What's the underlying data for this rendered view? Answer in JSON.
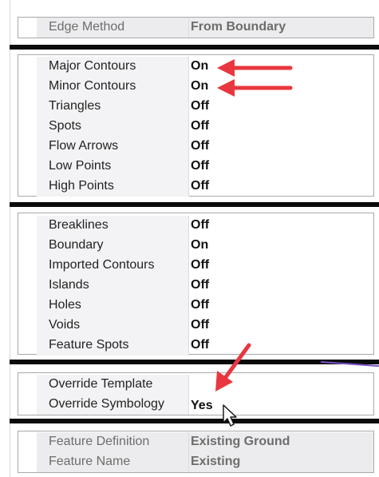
{
  "top_panel": {
    "rows": [
      {
        "label": "Edge Method",
        "value": "From Boundary"
      }
    ]
  },
  "display_panel": {
    "rows": [
      {
        "label": "Major Contours",
        "value": "On"
      },
      {
        "label": "Minor Contours",
        "value": "On"
      },
      {
        "label": "Triangles",
        "value": "Off"
      },
      {
        "label": "Spots",
        "value": "Off"
      },
      {
        "label": "Flow Arrows",
        "value": "Off"
      },
      {
        "label": "Low Points",
        "value": "Off"
      },
      {
        "label": "High Points",
        "value": "Off"
      }
    ]
  },
  "features_panel": {
    "rows": [
      {
        "label": "Breaklines",
        "value": "Off"
      },
      {
        "label": "Boundary",
        "value": "On"
      },
      {
        "label": "Imported Contours",
        "value": "Off"
      },
      {
        "label": "Islands",
        "value": "Off"
      },
      {
        "label": "Holes",
        "value": "Off"
      },
      {
        "label": "Voids",
        "value": "Off"
      },
      {
        "label": "Feature Spots",
        "value": "Off"
      }
    ]
  },
  "override_panel": {
    "rows": [
      {
        "label": "Override Template",
        "value": ""
      },
      {
        "label": "Override Symbology",
        "value": "Yes"
      }
    ]
  },
  "feature_panel": {
    "rows": [
      {
        "label": "Feature Definition",
        "value": "Existing Ground"
      },
      {
        "label": "Feature Name",
        "value": "Existing"
      }
    ]
  },
  "colors": {
    "annotation_arrow": "#e8373f",
    "divider": "#0b0b0b",
    "row_label_bg": "#f3f3f5"
  },
  "icons": {
    "annotation": "red-arrow-icon",
    "pointer": "mouse-pointer-icon"
  }
}
